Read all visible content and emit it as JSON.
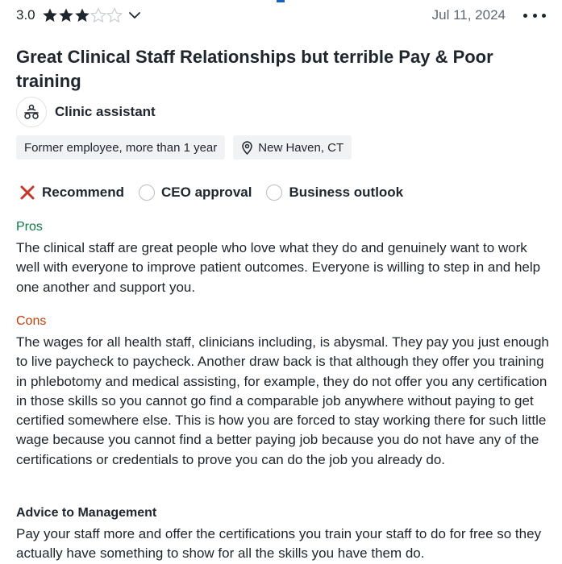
{
  "review": {
    "rating": "3.0",
    "stars_filled": 3,
    "stars_total": 5,
    "date": "Jul 11, 2024",
    "title": "Great Clinical Staff Relationships but terrible Pay & Poor training",
    "role": "Clinic assistant",
    "tags": {
      "employment": "Former employee, more than 1 year",
      "location": "New Haven, CT"
    },
    "indicators": {
      "recommend": "Recommend",
      "ceo": "CEO approval",
      "outlook": "Business outlook"
    },
    "pros": {
      "heading": "Pros",
      "text": "The clinical staff are great people who love what they do and genuinely want to work well with everyone to improve patient outcomes. Everyone is willing to step in and help one another and support you."
    },
    "cons": {
      "heading": "Cons",
      "text": "The wages for all health staff, clinicians including, is abysmal. They pay you just enough to live paycheck to paycheck. Another draw back is that although they offer you training in phlebotomy and medical assisting, for example, they do not offer you any certification in those skills so you cannot go find a comparable job anywhere without paying to get certified somewhere else. This is how you are forced to stay working there for such little wage because you cannot find a better paying job because you do not have any of the certifications or credentials to prove you can do the job you already do."
    },
    "advice": {
      "heading": "Advice to Management",
      "text": "Pay your staff more and offer the certifications you train your staff to do for free so they actually have something to show for all the skills you have them do."
    }
  },
  "icons": {
    "star_filled": "star-filled-icon",
    "star_empty": "star-empty-icon",
    "chevron": "chevron-down-icon",
    "more": "more-options-icon",
    "role": "employees-icon",
    "location": "location-pin-icon",
    "recommend": "x-mark-icon",
    "ceo": "empty-circle-icon",
    "outlook": "empty-circle-icon"
  },
  "colors": {
    "text": "#20262e",
    "muted": "#5e6672",
    "pros": "#0c7a43",
    "cons": "#c2410c",
    "x_mark": "#c4372b",
    "tag_bg": "#f1f2f4"
  }
}
